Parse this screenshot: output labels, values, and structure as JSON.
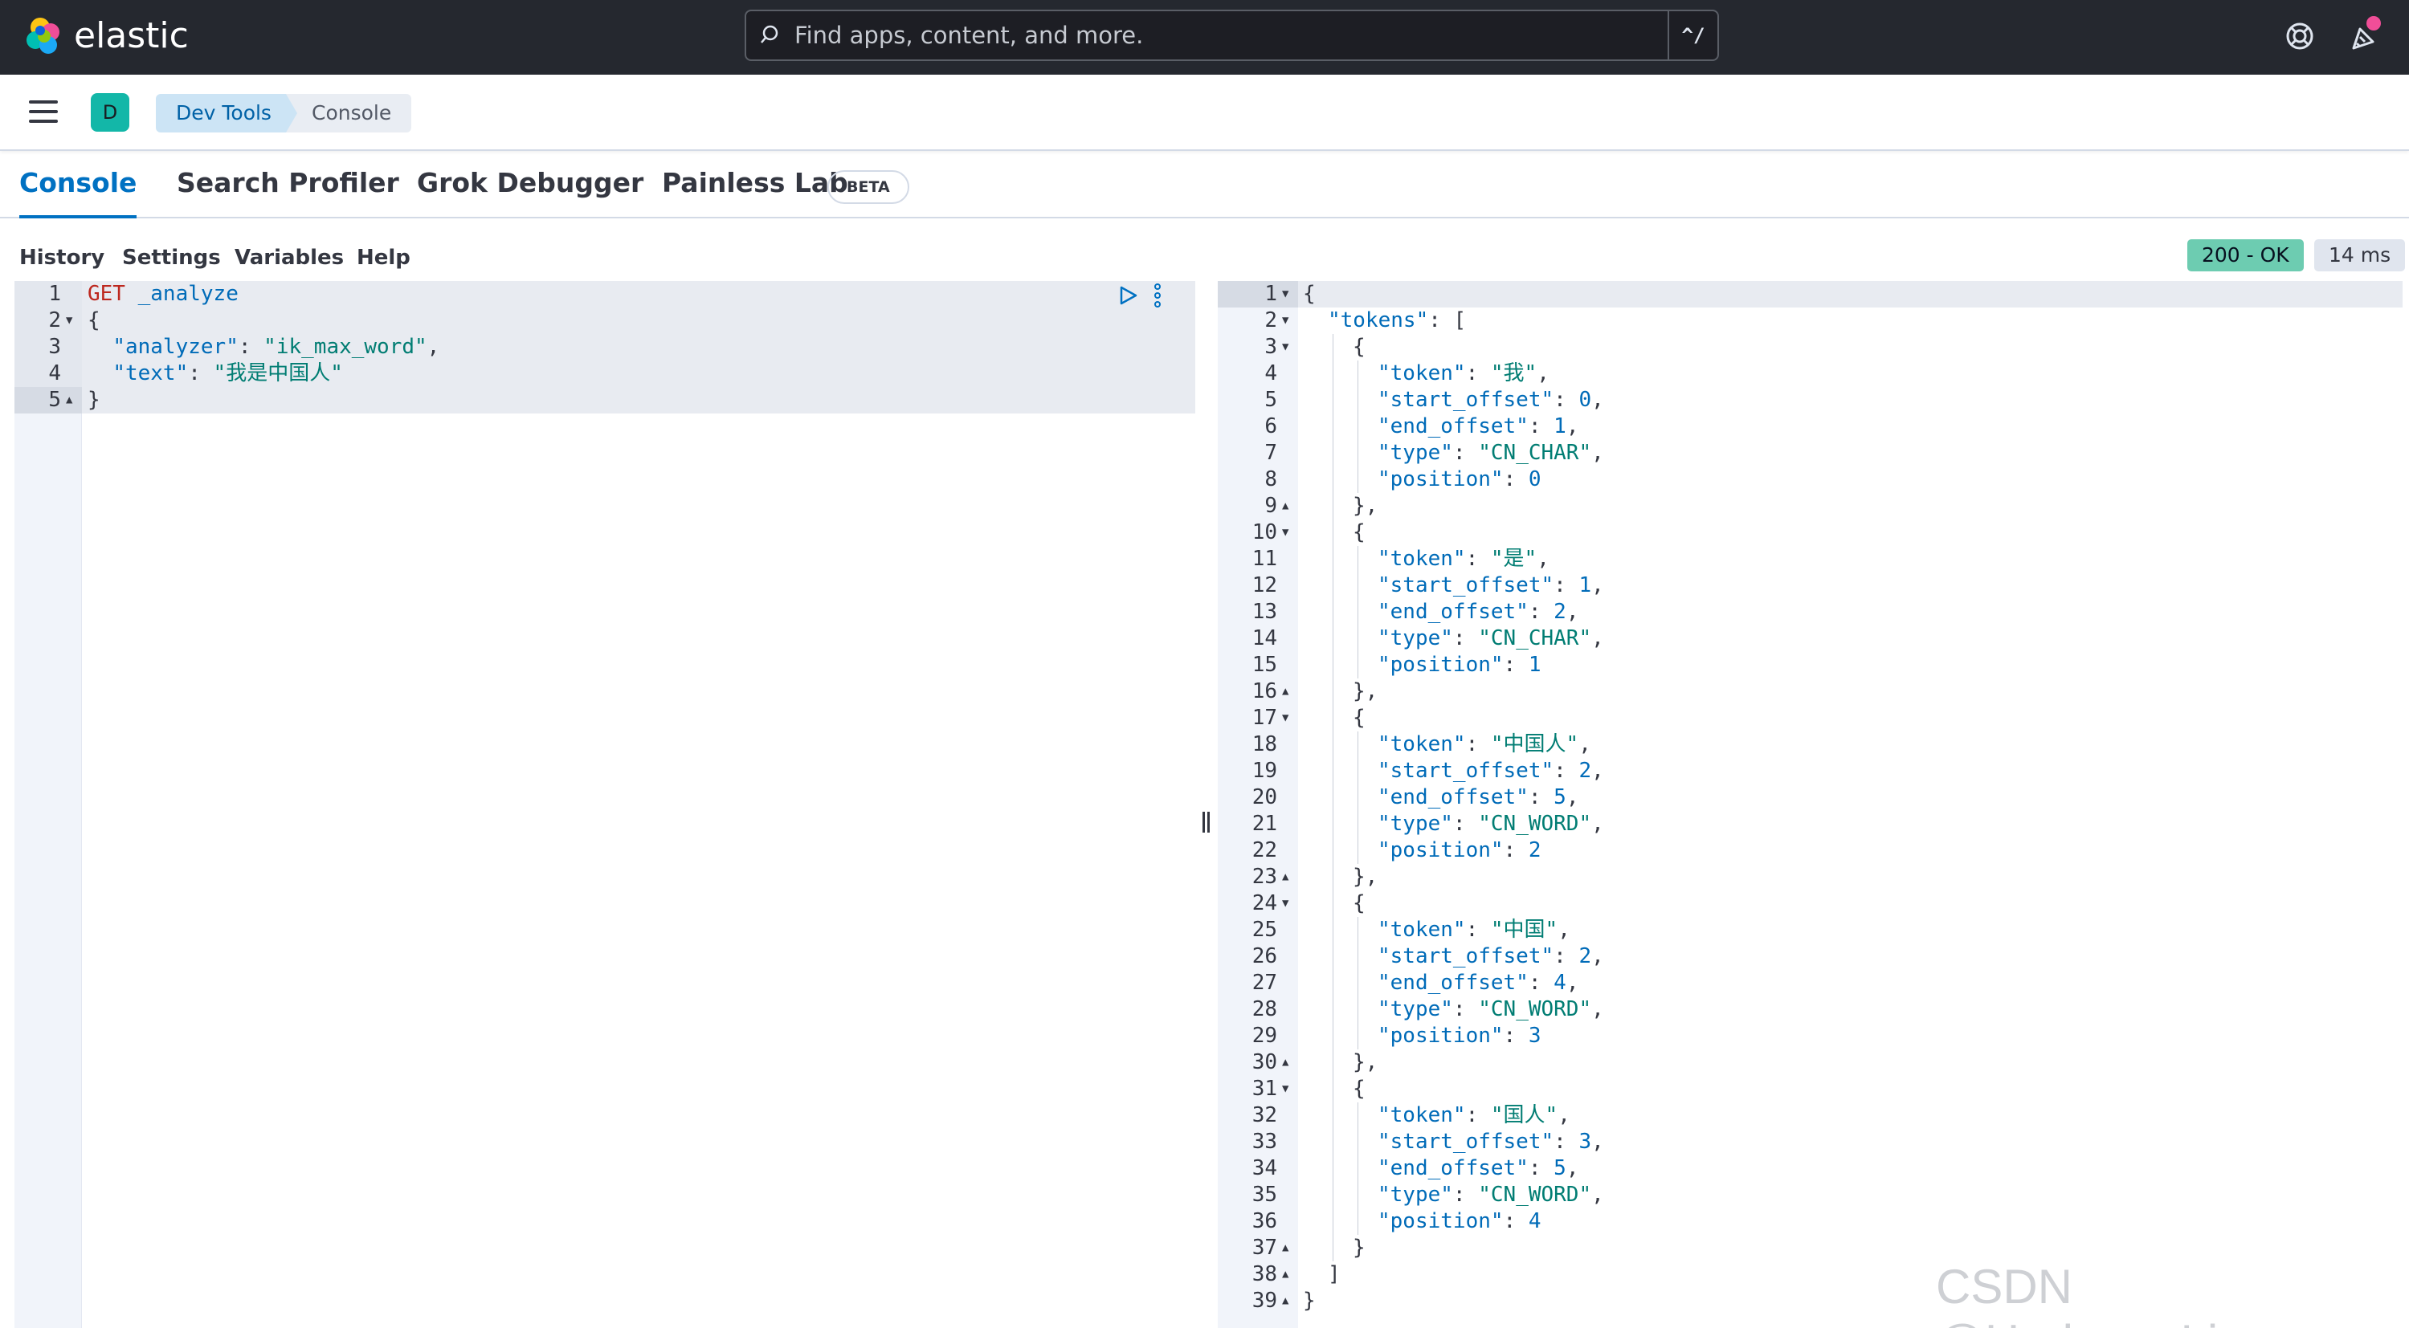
{
  "header": {
    "brand": "elastic",
    "search_placeholder": "Find apps, content, and more.",
    "search_shortcut": "^/"
  },
  "breadcrumbs": {
    "space_initial": "D",
    "items": [
      "Dev Tools",
      "Console"
    ]
  },
  "tabs": [
    {
      "label": "Console",
      "active": true
    },
    {
      "label": "Search Profiler",
      "active": false
    },
    {
      "label": "Grok Debugger",
      "active": false
    },
    {
      "label": "Painless Lab",
      "active": false
    }
  ],
  "beta_badge": "BETA",
  "toolbar": {
    "items": [
      "History",
      "Settings",
      "Variables",
      "Help"
    ],
    "status": "200 - OK",
    "elapsed": "14 ms"
  },
  "request": {
    "method": "GET",
    "path": "_analyze",
    "analyzer_key": "\"analyzer\"",
    "analyzer_value": "\"ik_max_word\"",
    "text_key": "\"text\"",
    "text_value": "\"我是中国人\""
  },
  "response_tokens": [
    {
      "token": "\"我\"",
      "start_offset": "0",
      "end_offset": "1",
      "type": "\"CN_CHAR\"",
      "position": "0"
    },
    {
      "token": "\"是\"",
      "start_offset": "1",
      "end_offset": "2",
      "type": "\"CN_CHAR\"",
      "position": "1"
    },
    {
      "token": "\"中国人\"",
      "start_offset": "2",
      "end_offset": "5",
      "type": "\"CN_WORD\"",
      "position": "2"
    },
    {
      "token": "\"中国\"",
      "start_offset": "2",
      "end_offset": "4",
      "type": "\"CN_WORD\"",
      "position": "3"
    },
    {
      "token": "\"国人\"",
      "start_offset": "3",
      "end_offset": "5",
      "type": "\"CN_WORD\"",
      "position": "4"
    }
  ],
  "response_keys": {
    "tokens": "\"tokens\"",
    "token": "\"token\"",
    "start_offset": "\"start_offset\"",
    "end_offset": "\"end_offset\"",
    "type": "\"type\"",
    "position": "\"position\""
  },
  "watermark": "CSDN @Hadoop_Liang",
  "icons": [
    "elastic-logo-icon",
    "search-icon",
    "help-icon",
    "news-icon",
    "menu-icon",
    "run-icon",
    "more-actions-icon",
    "resize-handle-icon"
  ],
  "colors": {
    "header_bg": "#25282f",
    "accent": "#0071c2",
    "status_ok": "#6dccb1",
    "string": "#017d73",
    "key": "#006bb8",
    "method": "#bd271e"
  }
}
